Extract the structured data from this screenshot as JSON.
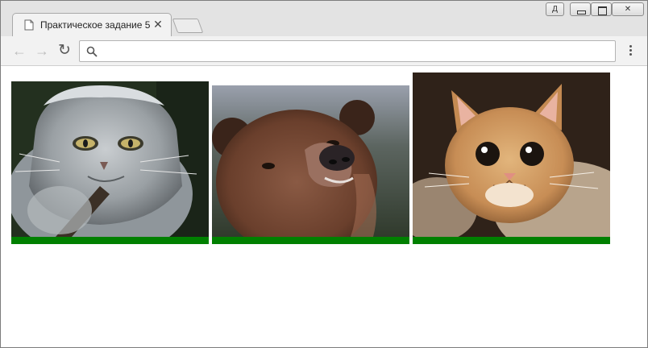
{
  "window": {
    "user_button_label": "Д",
    "close_button_label": "✕"
  },
  "tab": {
    "title": "Практическое задание 5",
    "close_label": "✕"
  },
  "toolbar": {
    "back_label": "←",
    "forward_label": "→",
    "reload_label": "↻",
    "address_value": "",
    "address_placeholder": ""
  },
  "gallery": {
    "accent_color": "#008000",
    "items": [
      {
        "name": "manul-cat-photo"
      },
      {
        "name": "brown-bear-photo"
      },
      {
        "name": "ginger-kitten-photo"
      }
    ]
  }
}
